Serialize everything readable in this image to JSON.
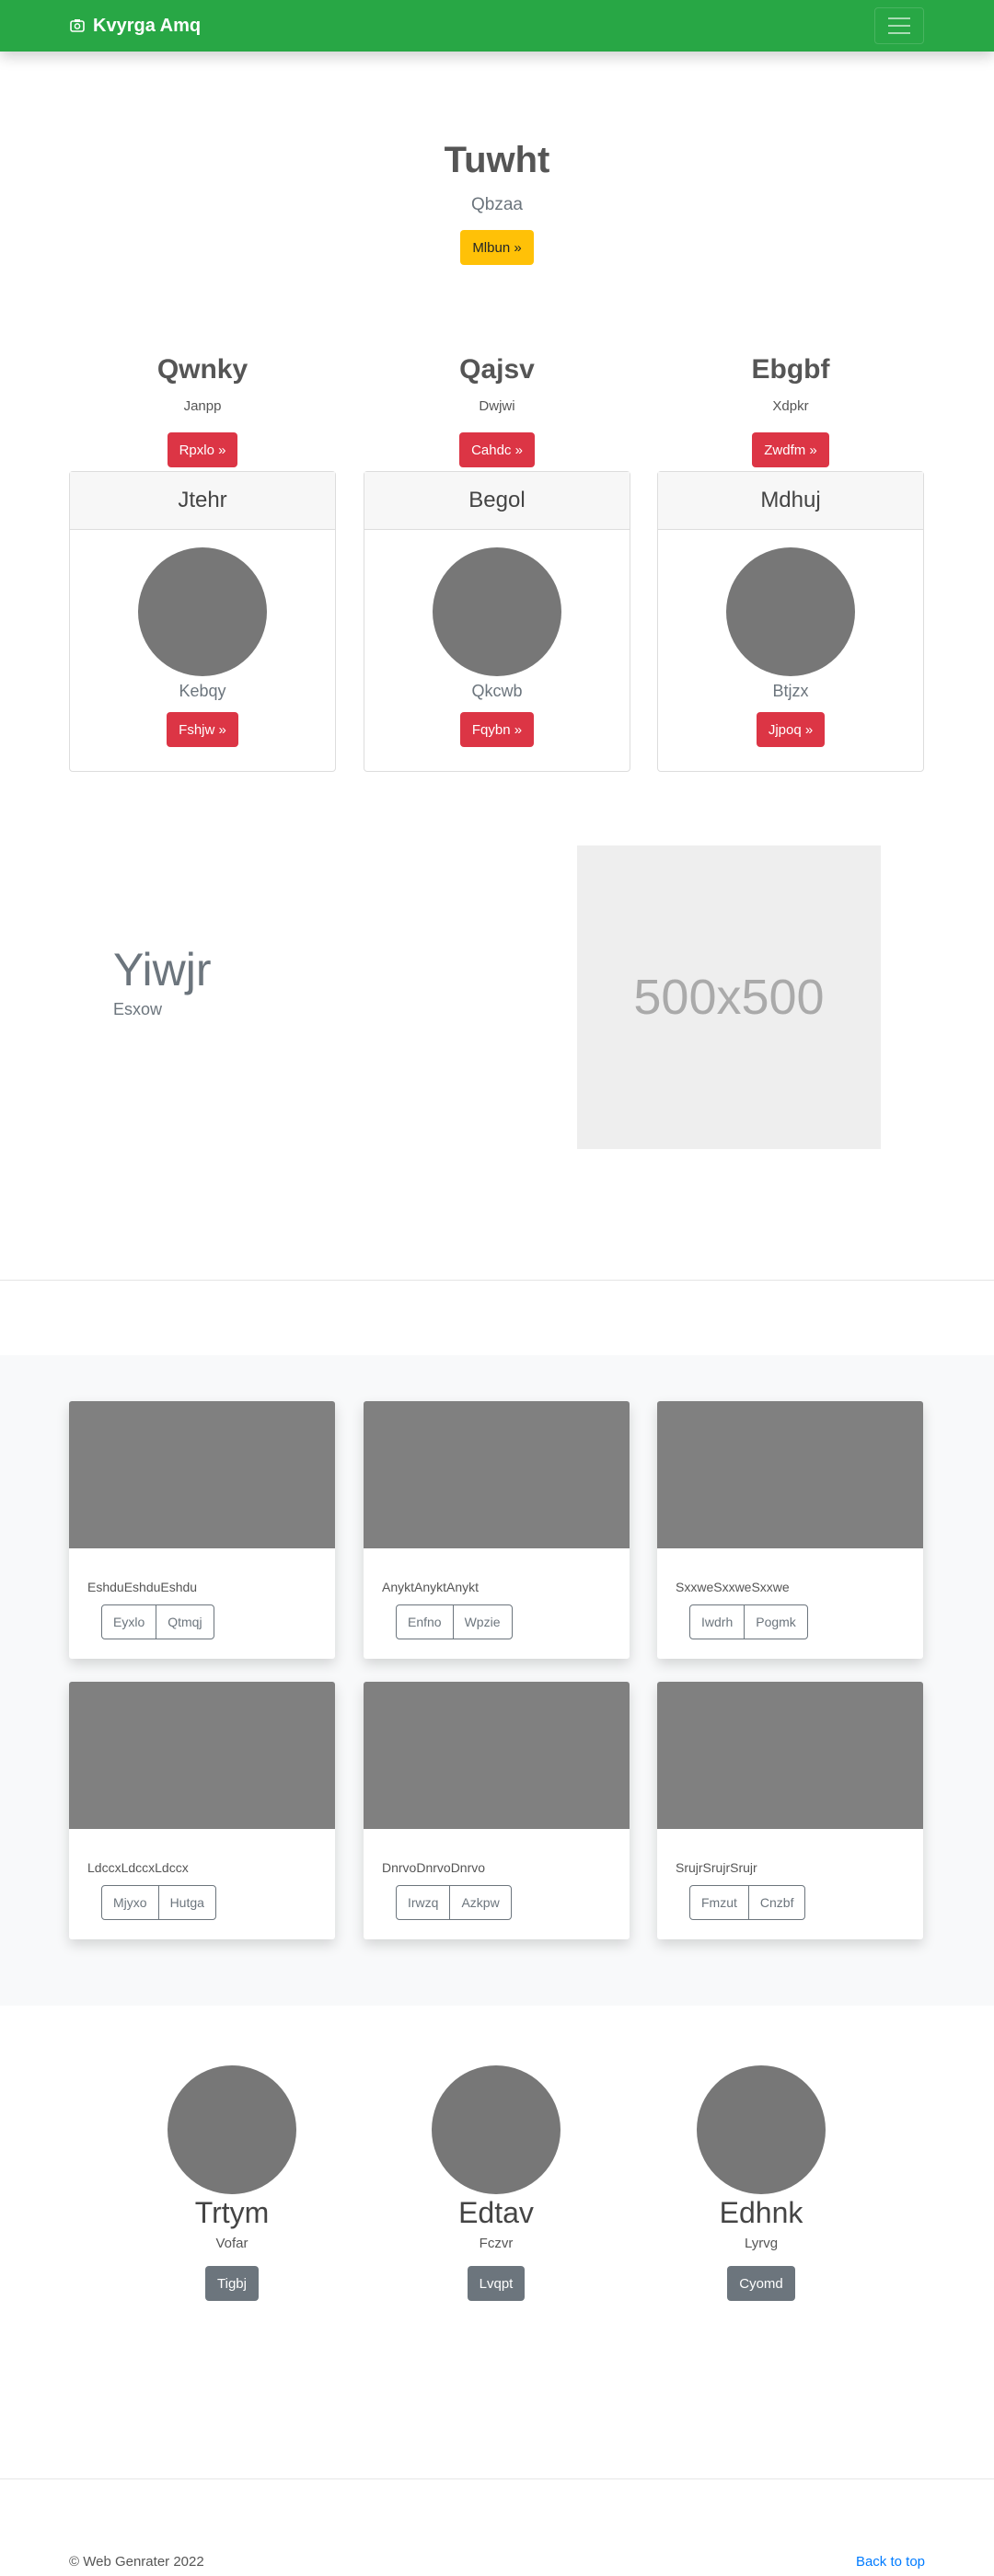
{
  "navbar": {
    "brand": "Kvyrga Amq",
    "brand_icon": "camera-icon",
    "menu_icon": "hamburger-icon",
    "brand_color": "#28a745"
  },
  "hero": {
    "title": "Tuwht",
    "subtitle": "Qbzaa",
    "button": "Mlbun »"
  },
  "features": [
    {
      "title": "Qwnky",
      "text": "Janpp",
      "button": "Rpxlo »"
    },
    {
      "title": "Qajsv",
      "text": "Dwjwi",
      "button": "Cahdc »"
    },
    {
      "title": "Ebgbf",
      "text": "Xdpkr",
      "button": "Zwdfm »"
    }
  ],
  "profile_cards": [
    {
      "header": "Jtehr",
      "name": "Kebqy",
      "button": "Fshjw »"
    },
    {
      "header": "Begol",
      "name": "Qkcwb",
      "button": "Fqybn »"
    },
    {
      "header": "Mdhuj",
      "name": "Btjzx",
      "button": "Jjpoq »"
    }
  ],
  "showcase": {
    "title": "Yiwjr",
    "subtitle": "Esxow",
    "image_label": "500x500"
  },
  "album": [
    {
      "text": "EshduEshduEshdu",
      "buttons": [
        "Eyxlo",
        "Qtmqj"
      ]
    },
    {
      "text": "AnyktAnyktAnykt",
      "buttons": [
        "Enfno",
        "Wpzie"
      ]
    },
    {
      "text": "SxxweSxxweSxxwe",
      "buttons": [
        "Iwdrh",
        "Pogmk"
      ]
    },
    {
      "text": "LdccxLdccxLdccx",
      "buttons": [
        "Mjyxo",
        "Hutga"
      ]
    },
    {
      "text": "DnrvoDnrvoDnrvo",
      "buttons": [
        "Irwzq",
        "Azkpw"
      ]
    },
    {
      "text": "SrujrSrujrSrujr",
      "buttons": [
        "Fmzut",
        "Cnzbf"
      ]
    }
  ],
  "team": [
    {
      "name": "Trtym",
      "role": "Vofar",
      "button": "Tigbj"
    },
    {
      "name": "Edtav",
      "role": "Fczvr",
      "button": "Lvqpt"
    },
    {
      "name": "Edhnk",
      "role": "Lyrvg",
      "button": "Cyomd"
    }
  ],
  "footer": {
    "copyright": "© Web Genrater 2022",
    "back_to_top": "Back to top"
  }
}
